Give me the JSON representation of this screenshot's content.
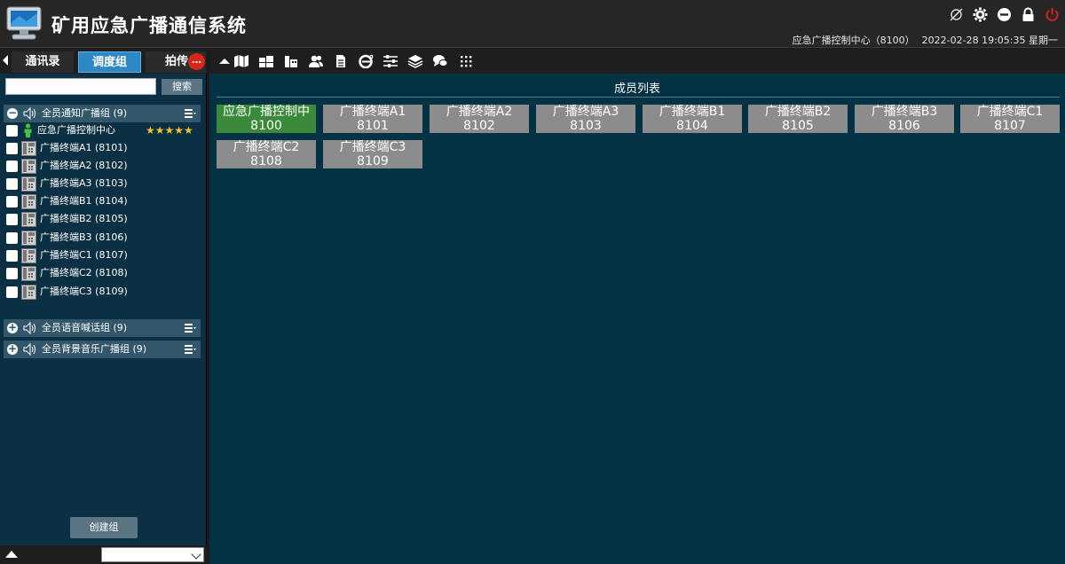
{
  "header": {
    "title": "矿用应急广播通信系统",
    "status_user": "应急广播控制中心（8100）",
    "status_datetime": "2022-02-28 19:05:35 星期一",
    "icons": [
      "no-link-icon",
      "gear-icon",
      "minimize-icon",
      "lock-icon",
      "power-icon"
    ],
    "power_color": "#e02020"
  },
  "left": {
    "tabs": [
      {
        "label": "通讯录",
        "active": false
      },
      {
        "label": "调度组",
        "active": true
      },
      {
        "label": "拍传",
        "active": false
      }
    ],
    "tab_badge": "…",
    "search": {
      "placeholder": "",
      "button": "搜索"
    },
    "groups": [
      {
        "label": "全员通知广播组 (9)",
        "expanded": true,
        "members": [
          {
            "name": "应急广播控制中心",
            "stars": "★★★★★",
            "type": "controller"
          },
          {
            "name": "广播终端A1 (8101)"
          },
          {
            "name": "广播终端A2 (8102)"
          },
          {
            "name": "广播终端A3 (8103)"
          },
          {
            "name": "广播终端B1 (8104)"
          },
          {
            "name": "广播终端B2 (8105)"
          },
          {
            "name": "广播终端B3 (8106)"
          },
          {
            "name": "广播终端C1 (8107)"
          },
          {
            "name": "广播终端C2 (8108)"
          },
          {
            "name": "广播终端C3 (8109)"
          }
        ]
      },
      {
        "label": "全员语音喊话组 (9)",
        "expanded": false
      },
      {
        "label": "全员背景音乐广播组 (9)",
        "expanded": false
      }
    ],
    "create_button": "创建组",
    "bottom_select_value": ""
  },
  "right": {
    "toolbar_icons": [
      "collapse-arrow-icon",
      "map-book-icon",
      "windows-icon",
      "building-icon",
      "users-icon",
      "document-icon",
      "browser-icon",
      "sliders-icon",
      "layers-icon",
      "chat-icon",
      "grid-icon"
    ],
    "list_title": "成员列表",
    "members": [
      {
        "name": "应急广播控制中",
        "number": "8100",
        "active": true
      },
      {
        "name": "广播终端A1",
        "number": "8101",
        "active": false
      },
      {
        "name": "广播终端A2",
        "number": "8102",
        "active": false
      },
      {
        "name": "广播终端A3",
        "number": "8103",
        "active": false
      },
      {
        "name": "广播终端B1",
        "number": "8104",
        "active": false
      },
      {
        "name": "广播终端B2",
        "number": "8105",
        "active": false
      },
      {
        "name": "广播终端B3",
        "number": "8106",
        "active": false
      },
      {
        "name": "广播终端C1",
        "number": "8107",
        "active": false
      },
      {
        "name": "广播终端C2",
        "number": "8108",
        "active": false
      },
      {
        "name": "广播终端C3",
        "number": "8109",
        "active": false
      }
    ]
  }
}
